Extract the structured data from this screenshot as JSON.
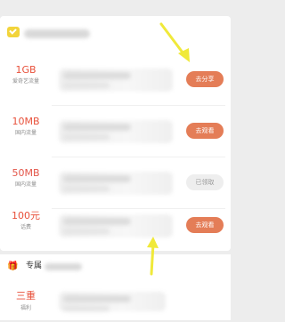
{
  "task_card": {
    "rows": [
      {
        "amount": "1GB",
        "type": "爱奇艺流量",
        "button": "去分享"
      },
      {
        "amount": "10MB",
        "type": "国内流量",
        "button": "去观看"
      },
      {
        "amount": "50MB",
        "type": "国内流量",
        "button": "已领取"
      },
      {
        "amount": "100元",
        "type": "话费",
        "button": "去观看"
      }
    ]
  },
  "exclusive": {
    "title": "专属",
    "row": {
      "amount": "三重",
      "type": "福利"
    }
  },
  "annotation": {
    "arrow_color": "#f0e93a"
  },
  "colors": {
    "accent": "#e47d57",
    "amount": "#e8513b",
    "disabled_button": "#eeeeee",
    "icon_yellow": "#f2d43b"
  }
}
